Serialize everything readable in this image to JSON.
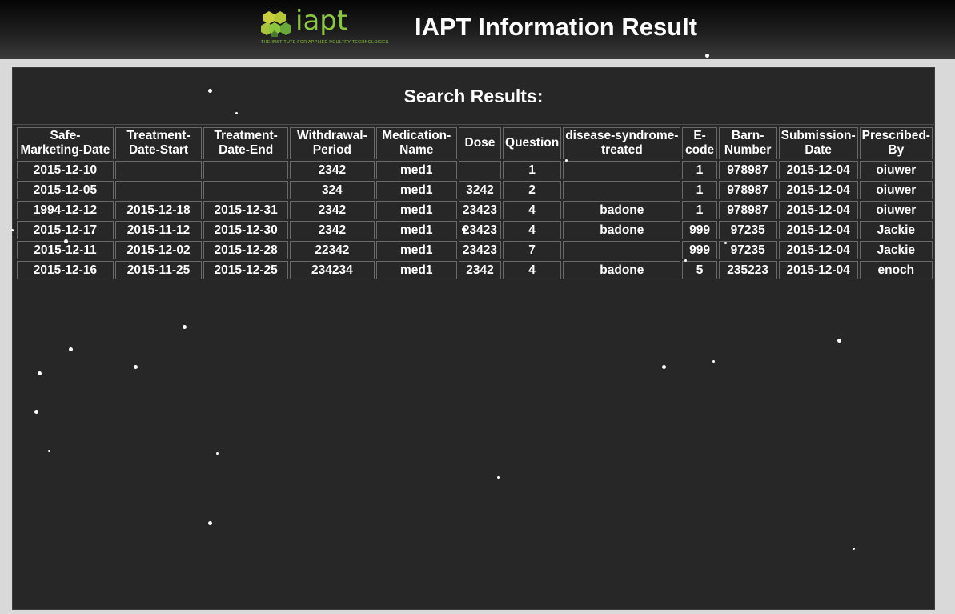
{
  "header": {
    "title": "IAPT Information Result",
    "logo": {
      "word": "iapt",
      "tagline": "THE INSTITUTE FOR APPLIED POULTRY TECHNOLOGIES",
      "color": "#8cc63f"
    }
  },
  "results": {
    "title": "Search Results:",
    "columns": [
      [
        "Safe-",
        "Marketing-Date"
      ],
      [
        "Treatment-",
        "Date-Start"
      ],
      [
        "Treatment-",
        "Date-End"
      ],
      [
        "Withdrawal-",
        "Period"
      ],
      [
        "Medication-",
        "Name"
      ],
      [
        "Dose"
      ],
      [
        "Question"
      ],
      [
        "disease-syndrome-",
        "treated"
      ],
      [
        "E-",
        "code"
      ],
      [
        "Barn-",
        "Number"
      ],
      [
        "Submission-",
        "Date"
      ],
      [
        "Prescribed-",
        "By"
      ]
    ],
    "rows": [
      [
        "2015-12-10",
        "",
        "",
        "2342",
        "med1",
        "",
        "1",
        "",
        "1",
        "978987",
        "2015-12-04",
        "oiuwer"
      ],
      [
        "2015-12-05",
        "",
        "",
        "324",
        "med1",
        "3242",
        "2",
        "",
        "1",
        "978987",
        "2015-12-04",
        "oiuwer"
      ],
      [
        "1994-12-12",
        "2015-12-18",
        "2015-12-31",
        "2342",
        "med1",
        "23423",
        "4",
        "badone",
        "1",
        "978987",
        "2015-12-04",
        "oiuwer"
      ],
      [
        "2015-12-17",
        "2015-11-12",
        "2015-12-30",
        "2342",
        "med1",
        "23423",
        "4",
        "badone",
        "999",
        "97235",
        "2015-12-04",
        "Jackie"
      ],
      [
        "2015-12-11",
        "2015-12-02",
        "2015-12-28",
        "22342",
        "med1",
        "23423",
        "7",
        "",
        "999",
        "97235",
        "2015-12-04",
        "Jackie"
      ],
      [
        "2015-12-16",
        "2015-11-25",
        "2015-12-25",
        "234234",
        "med1",
        "2342",
        "4",
        "badone",
        "5",
        "235223",
        "2015-12-04",
        "enoch"
      ]
    ]
  }
}
